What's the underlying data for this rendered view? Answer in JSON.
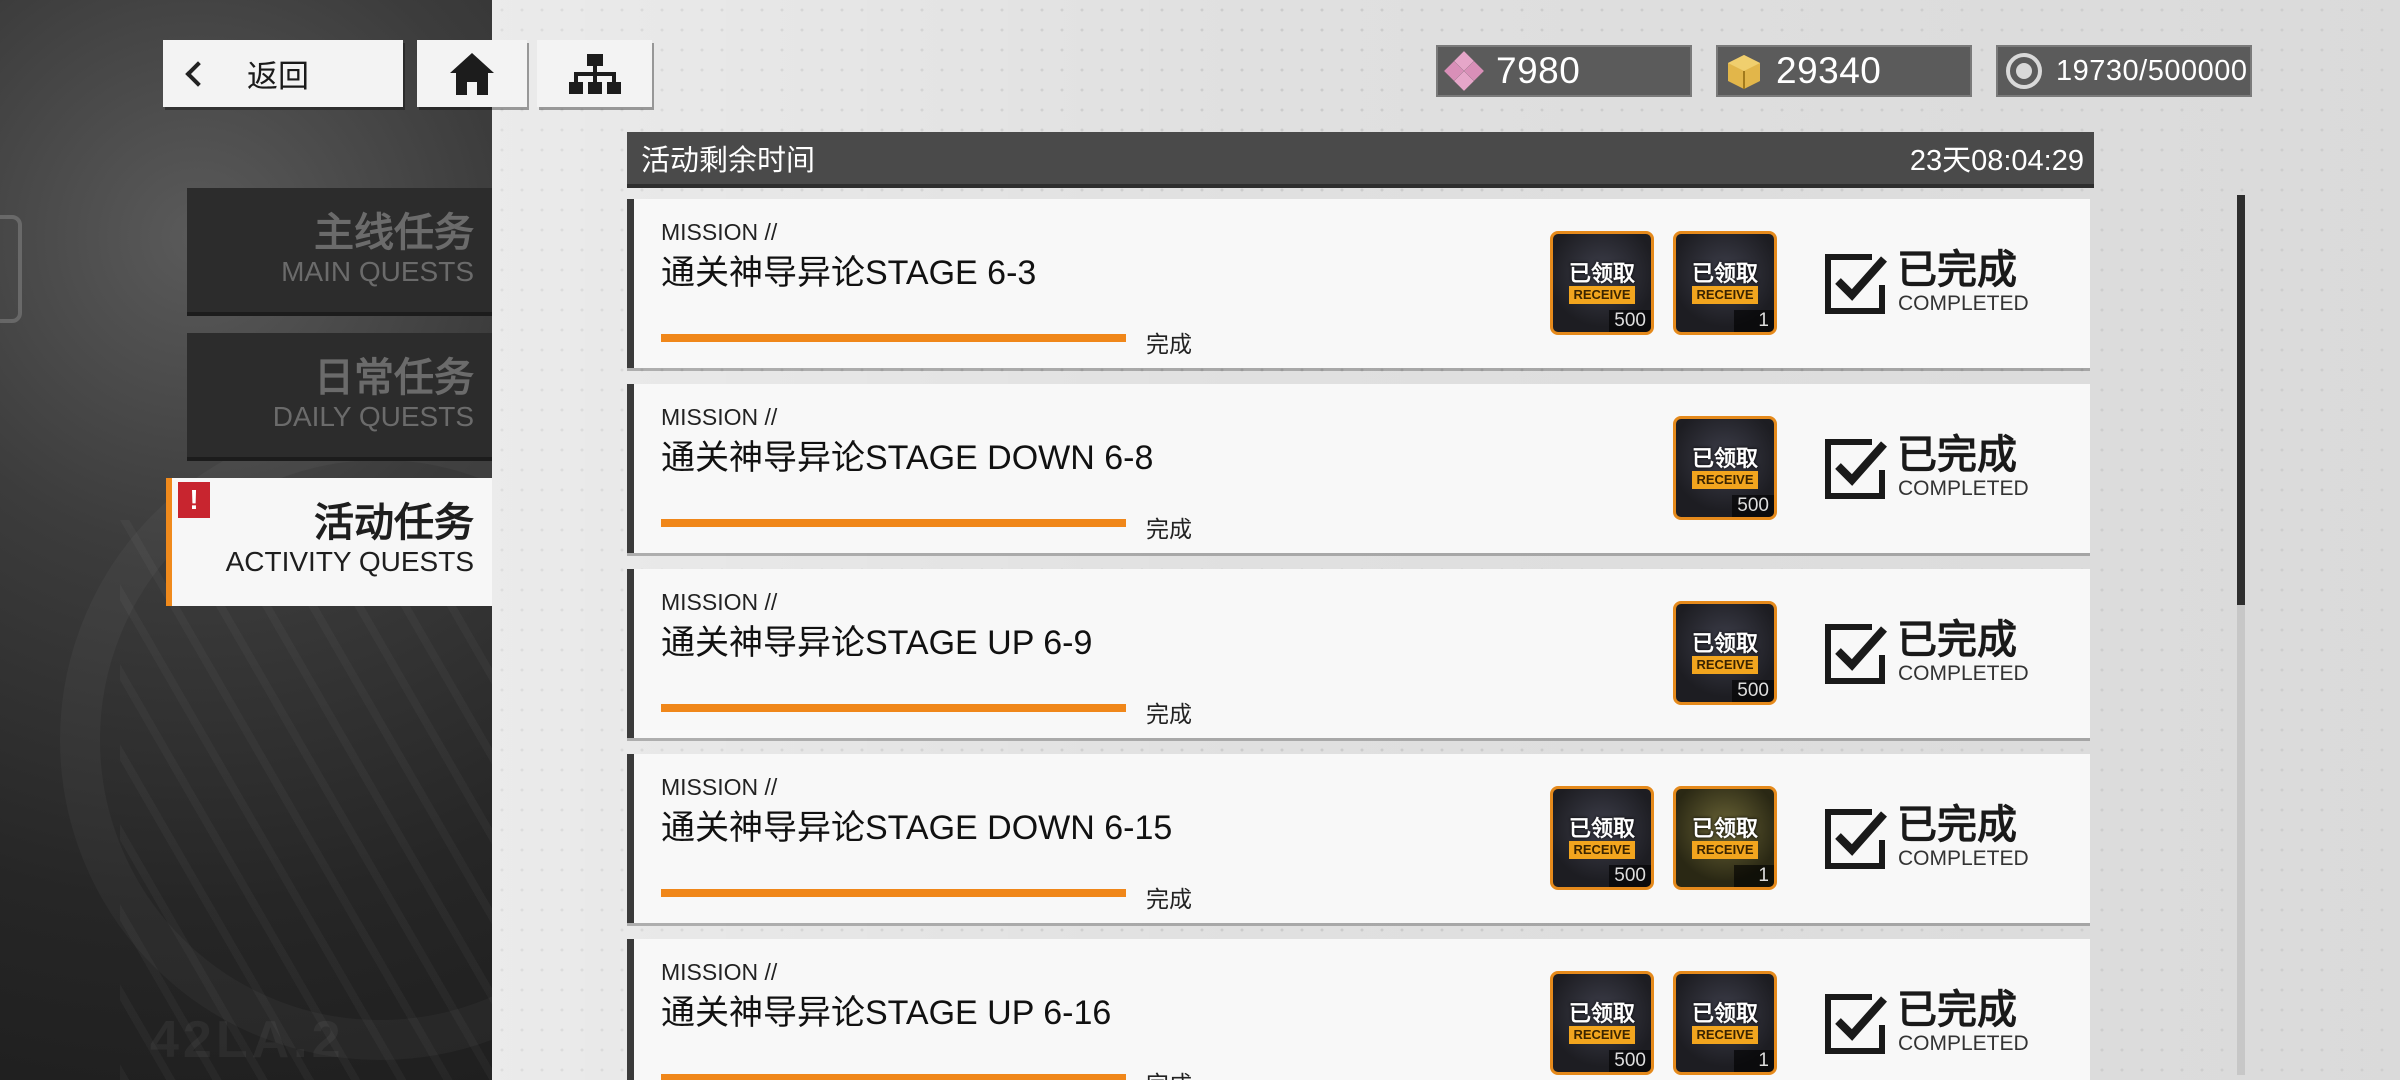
{
  "nav": {
    "back_label": "返回",
    "home_icon": "home-icon",
    "hierarchy_icon": "hierarchy-icon"
  },
  "currencies": [
    {
      "icon": "pink-crystal-icon",
      "value": "7980",
      "color": "#e6a6c9"
    },
    {
      "icon": "gold-box-icon",
      "value": "29340",
      "color": "#e2b64a"
    },
    {
      "icon": "stamina-icon",
      "value": "19730/500000",
      "color": "#d9d9d9"
    }
  ],
  "tabs": [
    {
      "cn": "主线任务",
      "en": "MAIN QUESTS",
      "active": false
    },
    {
      "cn": "日常任务",
      "en": "DAILY QUESTS",
      "active": false
    },
    {
      "cn": "活动任务",
      "en": "ACTIVITY QUESTS",
      "active": true,
      "alert": "!"
    }
  ],
  "timer": {
    "label": "活动剩余时间",
    "value": "23天08:04:29"
  },
  "quests": [
    {
      "tag": "MISSION //",
      "title": "通关神导异论STAGE 6-3",
      "progress": 1.0,
      "progress_text": "完成",
      "rewards": [
        {
          "claimed": "已领取",
          "receive": "RECEIVE",
          "qty": "500",
          "kind": "dark"
        },
        {
          "claimed": "已领取",
          "receive": "RECEIVE",
          "qty": "1",
          "kind": "dark"
        }
      ],
      "status_cn": "已完成",
      "status_en": "COMPLETED"
    },
    {
      "tag": "MISSION //",
      "title": "通关神导异论STAGE DOWN 6-8",
      "progress": 1.0,
      "progress_text": "完成",
      "rewards": [
        {
          "claimed": "已领取",
          "receive": "RECEIVE",
          "qty": "500",
          "kind": "dark"
        }
      ],
      "status_cn": "已完成",
      "status_en": "COMPLETED"
    },
    {
      "tag": "MISSION //",
      "title": "通关神导异论STAGE UP 6-9",
      "progress": 1.0,
      "progress_text": "完成",
      "rewards": [
        {
          "claimed": "已领取",
          "receive": "RECEIVE",
          "qty": "500",
          "kind": "dark"
        }
      ],
      "status_cn": "已完成",
      "status_en": "COMPLETED"
    },
    {
      "tag": "MISSION //",
      "title": "通关神导异论STAGE DOWN 6-15",
      "progress": 1.0,
      "progress_text": "完成",
      "rewards": [
        {
          "claimed": "已领取",
          "receive": "RECEIVE",
          "qty": "500",
          "kind": "dark"
        },
        {
          "claimed": "已领取",
          "receive": "RECEIVE",
          "qty": "1",
          "kind": "gold"
        }
      ],
      "status_cn": "已完成",
      "status_en": "COMPLETED"
    },
    {
      "tag": "MISSION //",
      "title": "通关神导异论STAGE UP 6-16",
      "progress": 1.0,
      "progress_text": "完成",
      "rewards": [
        {
          "claimed": "已领取",
          "receive": "RECEIVE",
          "qty": "500",
          "kind": "dark"
        },
        {
          "claimed": "已领取",
          "receive": "RECEIVE",
          "qty": "1",
          "kind": "dark"
        }
      ],
      "status_cn": "已完成",
      "status_en": "COMPLETED"
    }
  ],
  "colors": {
    "accent": "#f0871a",
    "alert": "#c8252f",
    "panel_dark": "#2c2c2c"
  },
  "watermark": "42LA.2"
}
